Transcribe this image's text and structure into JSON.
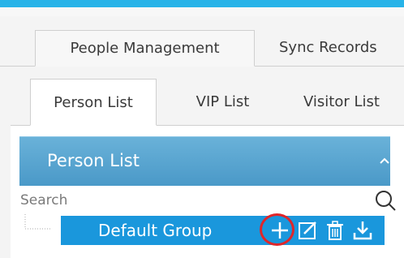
{
  "tabs_main": [
    "People Management",
    "Sync Records"
  ],
  "tabs_sub": [
    "Person List",
    "VIP List",
    "Visitor List"
  ],
  "panel": {
    "title": "Person List",
    "search_placeholder": "Search",
    "group": {
      "name": "Default Group",
      "action_icons": [
        "add-icon",
        "edit-icon",
        "delete-icon",
        "download-icon"
      ]
    }
  },
  "colors": {
    "top_bar": "#27b3e8",
    "panel_header": "#5aa8d3",
    "group_row": "#1a97dc",
    "highlight_ring": "#e0262a"
  }
}
